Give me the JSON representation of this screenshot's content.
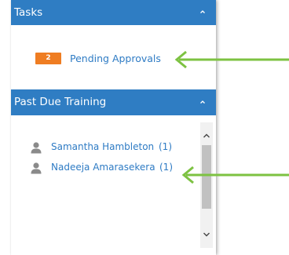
{
  "tasks_panel": {
    "title": "Tasks",
    "items": [
      {
        "badge": "2",
        "label": "Pending Approvals"
      }
    ]
  },
  "training_panel": {
    "title": "Past Due Training",
    "people": [
      {
        "name": "Samantha Hambleton",
        "count": "(1)"
      },
      {
        "name": "Nadeeja Amarasekera",
        "count": "(1)"
      }
    ]
  },
  "colors": {
    "header_bg": "#2f7dc3",
    "link": "#2e7bc4",
    "badge": "#ef7d22",
    "annotation_arrow": "#7dc242"
  },
  "icons": {
    "header_toggle": "chevron-up-icon",
    "person": "user-silhouette-icon",
    "scroll_up": "chevron-up-icon",
    "scroll_down": "chevron-down-icon",
    "annotation": "arrow-left-icon"
  }
}
